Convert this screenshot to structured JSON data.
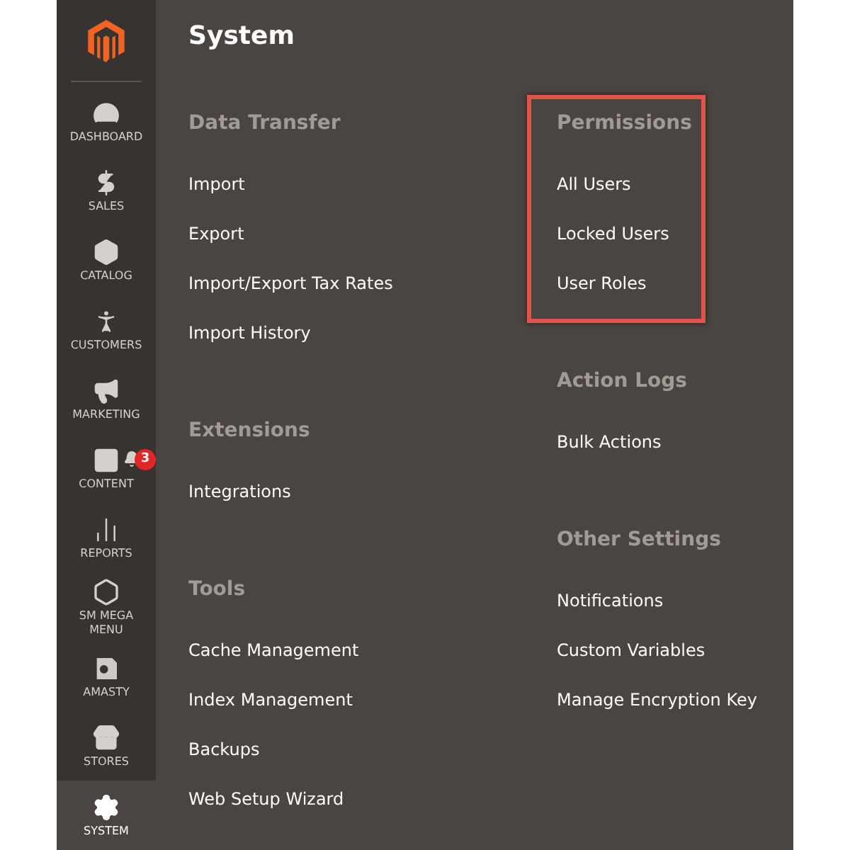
{
  "sidebar": {
    "items": [
      {
        "kind": "dashboard",
        "label": "DASHBOARD",
        "selected": false
      },
      {
        "kind": "sales",
        "label": "SALES",
        "selected": false
      },
      {
        "kind": "catalog",
        "label": "CATALOG",
        "selected": false
      },
      {
        "kind": "customers",
        "label": "CUSTOMERS",
        "selected": false
      },
      {
        "kind": "marketing",
        "label": "MARKETING",
        "selected": false
      },
      {
        "kind": "content",
        "label": "CONTENT",
        "selected": false,
        "badge": "3"
      },
      {
        "kind": "reports",
        "label": "REPORTS",
        "selected": false
      },
      {
        "kind": "megamenu",
        "label": "SM MEGA MENU",
        "selected": false
      },
      {
        "kind": "amasty",
        "label": "AMASTY",
        "selected": false
      },
      {
        "kind": "stores",
        "label": "STORES",
        "selected": false
      },
      {
        "kind": "system",
        "label": "SYSTEM",
        "selected": true
      }
    ]
  },
  "page": {
    "title": "System",
    "columns": [
      [
        {
          "heading": "Data Transfer",
          "highlighted": false,
          "items": [
            "Import",
            "Export",
            "Import/Export Tax Rates",
            "Import History"
          ]
        },
        {
          "heading": "Extensions",
          "highlighted": false,
          "items": [
            "Integrations"
          ]
        },
        {
          "heading": "Tools",
          "highlighted": false,
          "items": [
            "Cache Management",
            "Index Management",
            "Backups",
            "Web Setup Wizard"
          ]
        }
      ],
      [
        {
          "heading": "Permissions",
          "highlighted": true,
          "items": [
            "All Users",
            "Locked Users",
            "User Roles"
          ]
        },
        {
          "heading": "Action Logs",
          "highlighted": false,
          "items": [
            "Bulk Actions"
          ]
        },
        {
          "heading": "Other Settings",
          "highlighted": false,
          "items": [
            "Notifications",
            "Custom Variables",
            "Manage Encryption Key"
          ]
        }
      ]
    ]
  }
}
